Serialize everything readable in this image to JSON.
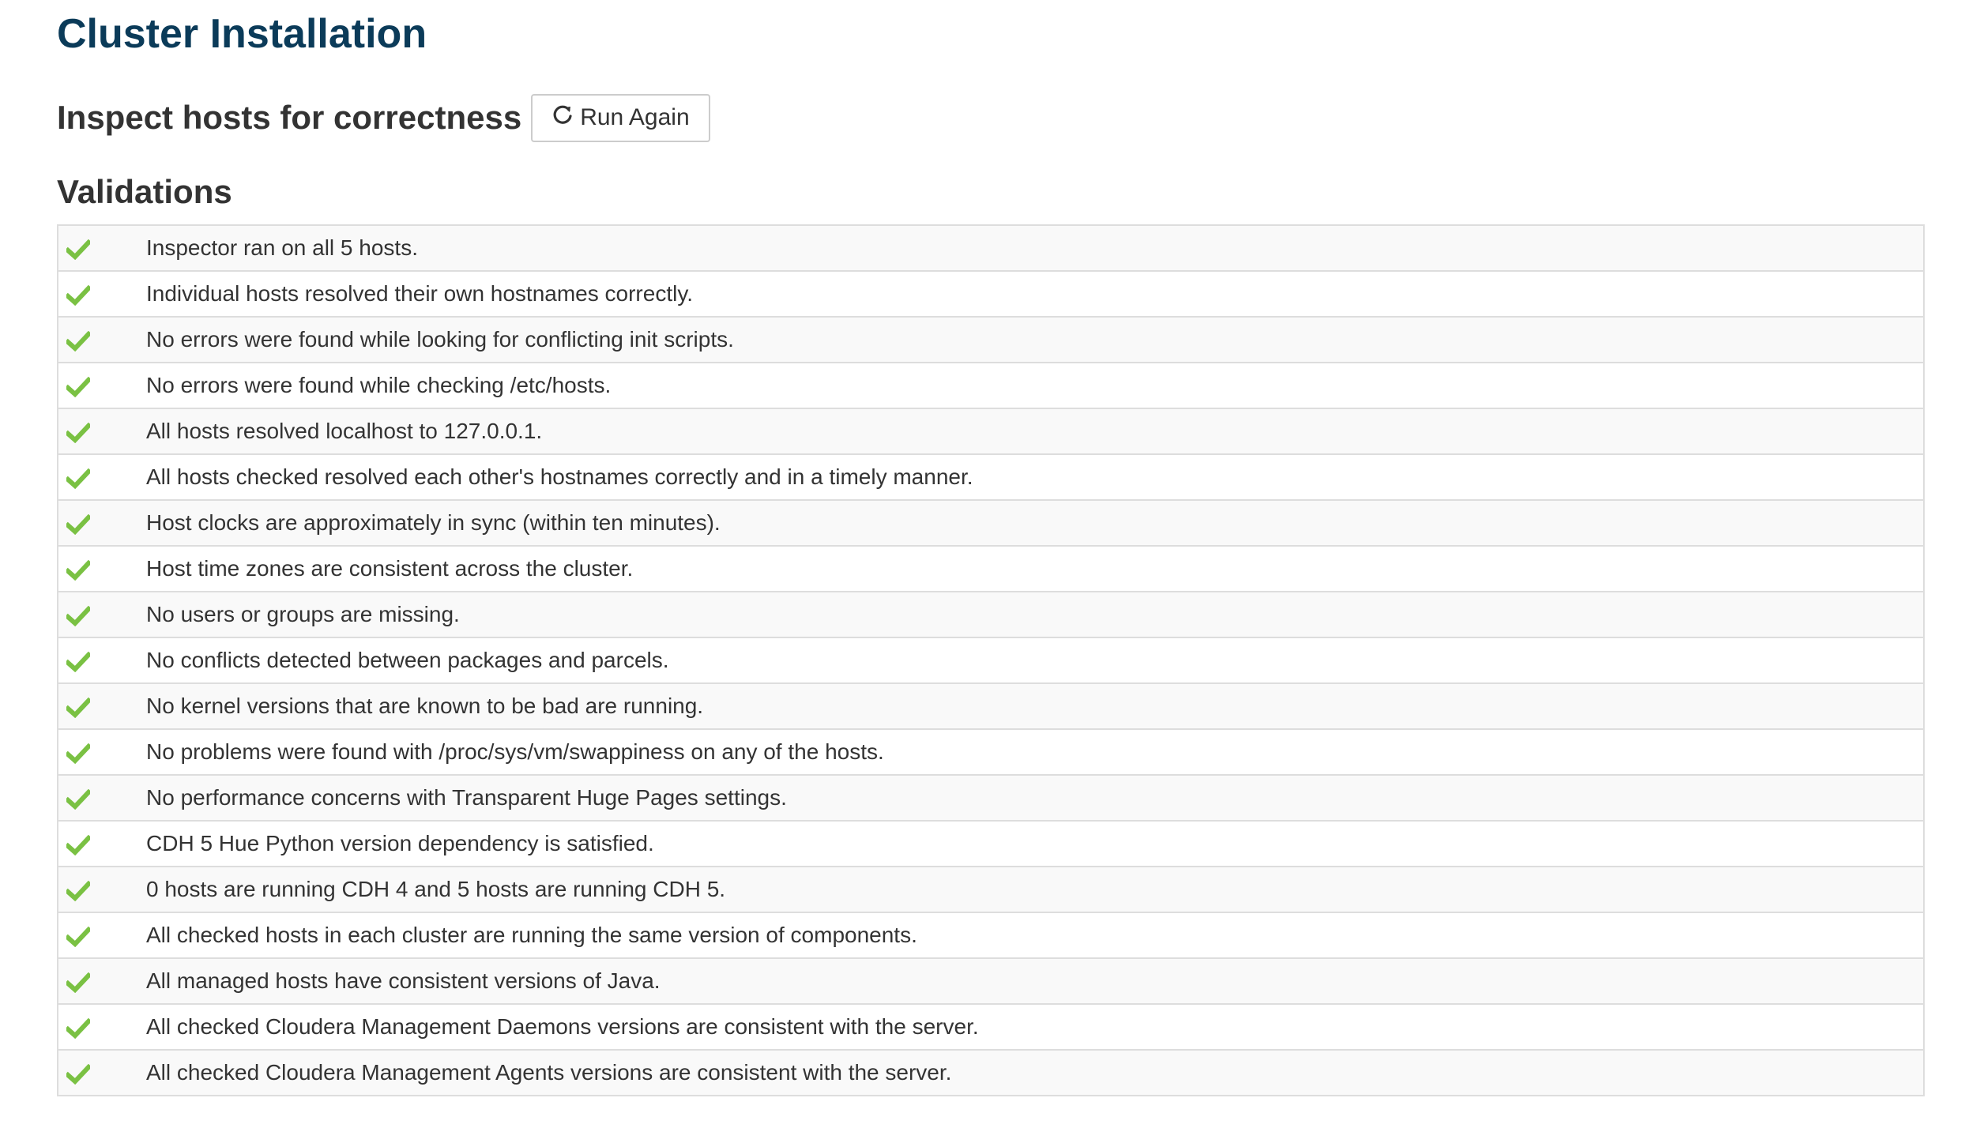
{
  "page_title": "Cluster Installation",
  "inspect": {
    "title": "Inspect hosts for correctness",
    "run_again_label": "Run Again",
    "run_again_icon": "refresh-icon"
  },
  "validations": {
    "title": "Validations",
    "status_icon": "checkmark-icon",
    "status_color": "#7ac143",
    "items": [
      {
        "status": "ok",
        "message": "Inspector ran on all 5 hosts."
      },
      {
        "status": "ok",
        "message": "Individual hosts resolved their own hostnames correctly."
      },
      {
        "status": "ok",
        "message": "No errors were found while looking for conflicting init scripts."
      },
      {
        "status": "ok",
        "message": "No errors were found while checking /etc/hosts."
      },
      {
        "status": "ok",
        "message": "All hosts resolved localhost to 127.0.0.1."
      },
      {
        "status": "ok",
        "message": "All hosts checked resolved each other's hostnames correctly and in a timely manner."
      },
      {
        "status": "ok",
        "message": "Host clocks are approximately in sync (within ten minutes)."
      },
      {
        "status": "ok",
        "message": "Host time zones are consistent across the cluster."
      },
      {
        "status": "ok",
        "message": "No users or groups are missing."
      },
      {
        "status": "ok",
        "message": "No conflicts detected between packages and parcels."
      },
      {
        "status": "ok",
        "message": "No kernel versions that are known to be bad are running."
      },
      {
        "status": "ok",
        "message": "No problems were found with /proc/sys/vm/swappiness on any of the hosts."
      },
      {
        "status": "ok",
        "message": "No performance concerns with Transparent Huge Pages settings."
      },
      {
        "status": "ok",
        "message": "CDH 5 Hue Python version dependency is satisfied."
      },
      {
        "status": "ok",
        "message": "0 hosts are running CDH 4 and 5 hosts are running CDH 5."
      },
      {
        "status": "ok",
        "message": "All checked hosts in each cluster are running the same version of components."
      },
      {
        "status": "ok",
        "message": "All managed hosts have consistent versions of Java."
      },
      {
        "status": "ok",
        "message": "All checked Cloudera Management Daemons versions are consistent with the server."
      },
      {
        "status": "ok",
        "message": "All checked Cloudera Management Agents versions are consistent with the server."
      }
    ]
  }
}
